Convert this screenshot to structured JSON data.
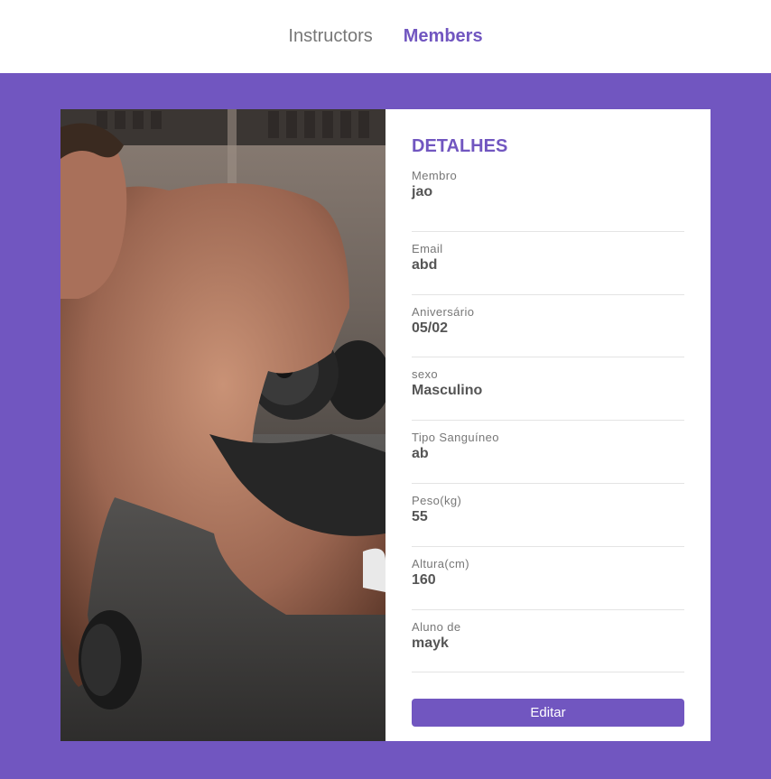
{
  "nav": {
    "items": [
      {
        "label": "Instructors",
        "active": false
      },
      {
        "label": "Members",
        "active": true
      }
    ]
  },
  "colors": {
    "accent": "#7156c0",
    "text_muted": "#777777",
    "text_value": "#555555",
    "divider": "#e4e4e4"
  },
  "photo": {
    "description_icon": "workout-photo"
  },
  "details": {
    "title": "DETALHES",
    "fields": [
      {
        "label": "Membro",
        "value": "jao"
      },
      {
        "label": "Email",
        "value": "abd"
      },
      {
        "label": "Aniversário",
        "value": "05/02"
      },
      {
        "label": "sexo",
        "value": "Masculino"
      },
      {
        "label": "Tipo Sanguíneo",
        "value": "ab"
      },
      {
        "label": "Peso(kg)",
        "value": "55"
      },
      {
        "label": "Altura(cm)",
        "value": "160"
      },
      {
        "label": "Aluno de",
        "value": "mayk"
      }
    ],
    "edit_label": "Editar"
  }
}
